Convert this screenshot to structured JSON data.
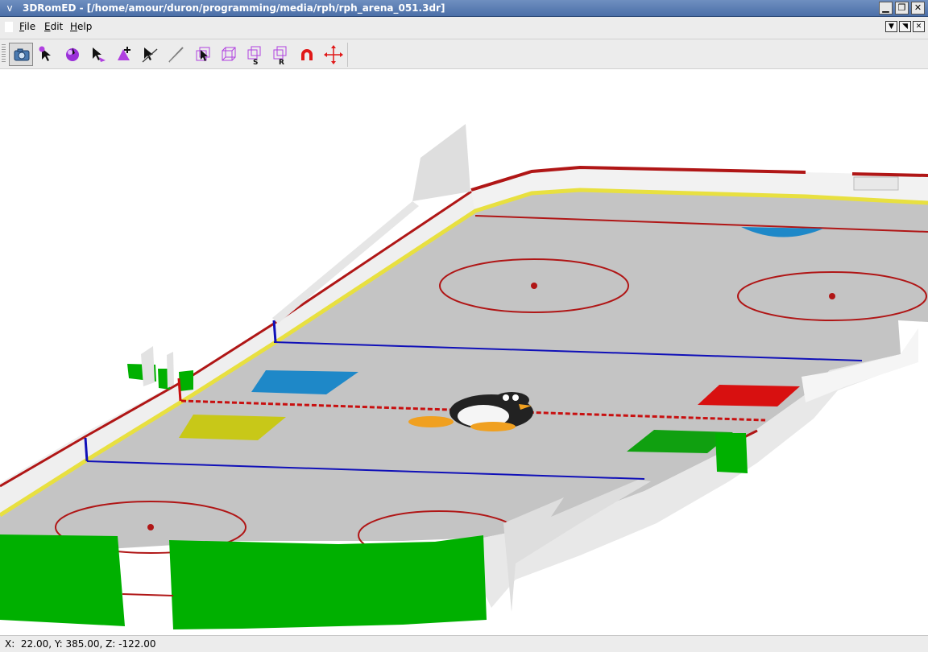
{
  "window": {
    "title": "3DRomED - [/home/amour/duron/programming/media/rph/rph_arena_051.3dr]",
    "menu_glyph": "v",
    "minimize_glyph": "▁",
    "maximize_glyph": "❐",
    "close_glyph": "✕"
  },
  "menubar": {
    "items": [
      {
        "label": "ile",
        "mnemonic": "F"
      },
      {
        "label": "dit",
        "mnemonic": "E"
      },
      {
        "label": "elp",
        "mnemonic": "H"
      }
    ],
    "mdi_buttons": [
      "▼",
      "◥",
      "✕"
    ]
  },
  "toolbar": {
    "tools": [
      {
        "icon": "camera-icon",
        "active": true
      },
      {
        "icon": "select-vertex-icon"
      },
      {
        "icon": "select-sphere-icon"
      },
      {
        "icon": "select-face-icon"
      },
      {
        "icon": "add-face-icon"
      },
      {
        "icon": "pick-edge-icon"
      },
      {
        "icon": "line-icon"
      },
      {
        "icon": "select-box-icon"
      },
      {
        "icon": "box-icon"
      },
      {
        "icon": "scale-box-icon",
        "letter": "S"
      },
      {
        "icon": "rotate-box-icon",
        "letter": "R"
      },
      {
        "icon": "magnet-icon"
      },
      {
        "icon": "move-arrows-icon"
      }
    ]
  },
  "status": {
    "coords": "X:  22.00, Y: 385.00, Z: -122.00"
  },
  "colors": {
    "title_bg": "#4b6fa8",
    "ice": "#c4c4c4",
    "board_red": "#b01616",
    "board_yellow": "#e8e040",
    "blue_line": "#1010b8",
    "green_block": "#00b000",
    "pad_blue": "#1e88c8",
    "pad_yellow": "#c8c818",
    "pad_red": "#d81010",
    "pad_green": "#10a010"
  }
}
